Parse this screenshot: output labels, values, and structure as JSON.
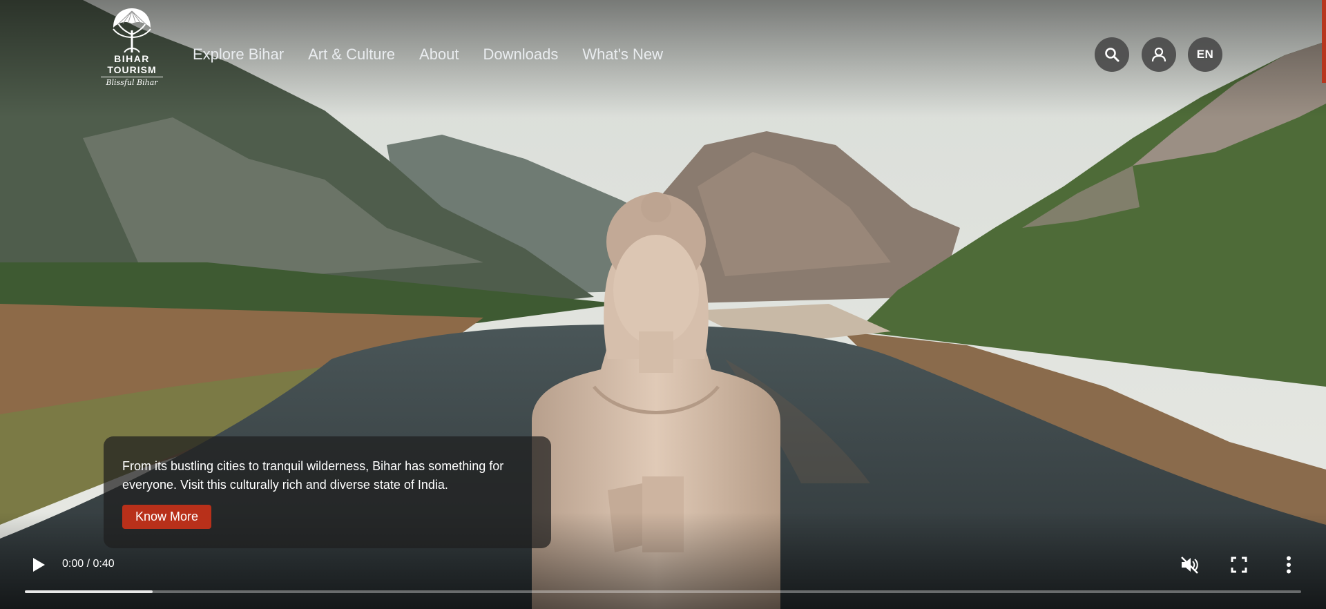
{
  "brand": {
    "line1": "BIHAR",
    "line2": "TOURISM",
    "tagline": "Blissful Bihar"
  },
  "nav": {
    "items": [
      {
        "label": "Explore Bihar"
      },
      {
        "label": "Art & Culture"
      },
      {
        "label": "About"
      },
      {
        "label": "Downloads"
      },
      {
        "label": "What's New"
      }
    ]
  },
  "header": {
    "language": "EN",
    "icons": [
      "search-icon",
      "user-icon"
    ]
  },
  "hero": {
    "description": "From its bustling cities to tranquil wilderness, Bihar has something for everyone. Visit this culturally rich and diverse state of India.",
    "cta_label": "Know More"
  },
  "video": {
    "time": "0:00 / 0:40",
    "progress_fraction": 0.1,
    "icons": [
      "play-icon",
      "mute-icon",
      "fullscreen-icon",
      "more-options-icon"
    ]
  },
  "colors": {
    "accent": "#b8301a",
    "card_bg": "#1e1e1e",
    "button_bg": "#4b4b4b"
  }
}
